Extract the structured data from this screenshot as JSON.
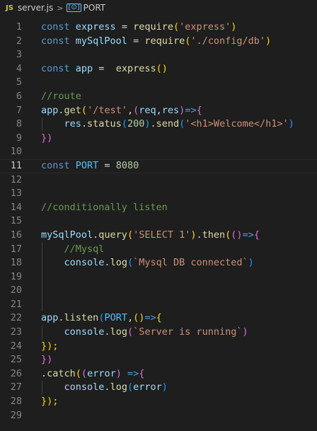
{
  "colors": {
    "background": "#1e1e1e",
    "keyword": "#569cd6",
    "function": "#dcdcaa",
    "variable": "#9cdcfe",
    "constant": "#4fc1ff",
    "string": "#ce9178",
    "number": "#b5cea8",
    "comment": "#6a9955",
    "plain": "#d4d4d4",
    "bracket1": "#ffd700",
    "bracket2": "#da70d6",
    "bracket3": "#179fff",
    "line_number": "#858585",
    "line_number_active": "#c6c6c6"
  },
  "breadcrumb": {
    "file_icon": "JS",
    "file_name": "server.js",
    "separator": ">",
    "symbol_icon": "symbol-constant-icon",
    "symbol_icon_glyph": "[⊙]",
    "symbol_name": "PORT"
  },
  "editor": {
    "active_line": 11,
    "lines": [
      {
        "n": "1",
        "tokens": [
          [
            "const",
            "keyword"
          ],
          [
            " ",
            "plain"
          ],
          [
            "express",
            "variable"
          ],
          [
            " = ",
            "plain"
          ],
          [
            "require",
            "function"
          ],
          [
            "(",
            "bracket1"
          ],
          [
            "'express'",
            "string"
          ],
          [
            ")",
            "bracket1"
          ]
        ]
      },
      {
        "n": "2",
        "tokens": [
          [
            "const",
            "keyword"
          ],
          [
            " ",
            "plain"
          ],
          [
            "mySqlPool",
            "variable"
          ],
          [
            " = ",
            "plain"
          ],
          [
            "require",
            "function"
          ],
          [
            "(",
            "bracket1"
          ],
          [
            "'./config/db'",
            "string"
          ],
          [
            ")",
            "bracket1"
          ]
        ]
      },
      {
        "n": "3",
        "tokens": []
      },
      {
        "n": "4",
        "tokens": [
          [
            "const",
            "keyword"
          ],
          [
            " ",
            "plain"
          ],
          [
            "app",
            "variable"
          ],
          [
            " =  ",
            "plain"
          ],
          [
            "express",
            "function"
          ],
          [
            "()",
            "bracket1"
          ]
        ]
      },
      {
        "n": "5",
        "tokens": []
      },
      {
        "n": "6",
        "tokens": [
          [
            "//route",
            "comment"
          ]
        ]
      },
      {
        "n": "7",
        "tokens": [
          [
            "app",
            "variable"
          ],
          [
            ".",
            "plain"
          ],
          [
            "get",
            "function"
          ],
          [
            "(",
            "bracket1"
          ],
          [
            "'/test'",
            "string"
          ],
          [
            ",",
            "plain"
          ],
          [
            "(",
            "bracket2"
          ],
          [
            "req",
            "variable"
          ],
          [
            ",",
            "plain"
          ],
          [
            "res",
            "variable"
          ],
          [
            ")",
            "bracket2"
          ],
          [
            "=>",
            "keyword"
          ],
          [
            "{",
            "bracket2"
          ]
        ]
      },
      {
        "n": "8",
        "tokens": [
          [
            "    ",
            "plain"
          ],
          [
            "res",
            "variable"
          ],
          [
            ".",
            "plain"
          ],
          [
            "status",
            "function"
          ],
          [
            "(",
            "bracket3"
          ],
          [
            "200",
            "number"
          ],
          [
            ")",
            "bracket3"
          ],
          [
            ".",
            "plain"
          ],
          [
            "send",
            "function"
          ],
          [
            "(",
            "bracket3"
          ],
          [
            "'<h1>Welcome</h1>'",
            "string"
          ],
          [
            ")",
            "bracket3"
          ]
        ]
      },
      {
        "n": "9",
        "tokens": [
          [
            "})",
            "bracket2"
          ]
        ]
      },
      {
        "n": "10",
        "tokens": []
      },
      {
        "n": "11",
        "tokens": [
          [
            "const",
            "keyword"
          ],
          [
            " ",
            "plain"
          ],
          [
            "PORT",
            "constant"
          ],
          [
            " = ",
            "plain"
          ],
          [
            "8080",
            "number"
          ]
        ]
      },
      {
        "n": "12",
        "tokens": []
      },
      {
        "n": "13",
        "tokens": []
      },
      {
        "n": "14",
        "tokens": [
          [
            "//conditionally listen",
            "comment"
          ]
        ]
      },
      {
        "n": "15",
        "tokens": []
      },
      {
        "n": "16",
        "tokens": [
          [
            "mySqlPool",
            "variable"
          ],
          [
            ".",
            "plain"
          ],
          [
            "query",
            "function"
          ],
          [
            "(",
            "bracket1"
          ],
          [
            "'SELECT 1'",
            "string"
          ],
          [
            ")",
            "bracket1"
          ],
          [
            ".",
            "plain"
          ],
          [
            "then",
            "function"
          ],
          [
            "(",
            "bracket1"
          ],
          [
            "()",
            "bracket2"
          ],
          [
            "=>",
            "keyword"
          ],
          [
            "{",
            "bracket2"
          ]
        ]
      },
      {
        "n": "17",
        "tokens": [
          [
            "    ",
            "plain"
          ],
          [
            "//Mysql",
            "comment"
          ]
        ]
      },
      {
        "n": "18",
        "tokens": [
          [
            "    ",
            "plain"
          ],
          [
            "console",
            "variable"
          ],
          [
            ".",
            "plain"
          ],
          [
            "log",
            "function"
          ],
          [
            "(",
            "bracket3"
          ],
          [
            "`Mysql DB connected`",
            "string"
          ],
          [
            ")",
            "bracket3"
          ]
        ]
      },
      {
        "n": "19",
        "tokens": []
      },
      {
        "n": "20",
        "tokens": []
      },
      {
        "n": "21",
        "tokens": []
      },
      {
        "n": "22",
        "tokens": [
          [
            "app",
            "variable"
          ],
          [
            ".",
            "plain"
          ],
          [
            "listen",
            "function"
          ],
          [
            "(",
            "bracket3"
          ],
          [
            "PORT",
            "constant"
          ],
          [
            ",",
            "plain"
          ],
          [
            "()",
            "bracket1"
          ],
          [
            "=>",
            "keyword"
          ],
          [
            "{",
            "bracket1"
          ]
        ]
      },
      {
        "n": "23",
        "tokens": [
          [
            "    ",
            "plain"
          ],
          [
            "console",
            "variable"
          ],
          [
            ".",
            "plain"
          ],
          [
            "log",
            "function"
          ],
          [
            "(",
            "bracket2"
          ],
          [
            "`Server is running`",
            "string"
          ],
          [
            ")",
            "bracket2"
          ]
        ]
      },
      {
        "n": "24",
        "tokens": [
          [
            "});",
            "bracket1"
          ]
        ]
      },
      {
        "n": "25",
        "tokens": [
          [
            "})",
            "bracket2"
          ]
        ]
      },
      {
        "n": "26",
        "tokens": [
          [
            ".",
            "plain"
          ],
          [
            "catch",
            "function"
          ],
          [
            "(",
            "bracket1"
          ],
          [
            "(",
            "bracket2"
          ],
          [
            "error",
            "variable"
          ],
          [
            ")",
            "bracket2"
          ],
          [
            " =>",
            "keyword"
          ],
          [
            "{",
            "bracket2"
          ]
        ]
      },
      {
        "n": "27",
        "tokens": [
          [
            "    ",
            "plain"
          ],
          [
            "console",
            "variable"
          ],
          [
            ".",
            "plain"
          ],
          [
            "log",
            "function"
          ],
          [
            "(",
            "bracket3"
          ],
          [
            "error",
            "variable"
          ],
          [
            ")",
            "bracket3"
          ]
        ]
      },
      {
        "n": "28",
        "tokens": [
          [
            "});",
            "bracket1"
          ]
        ]
      },
      {
        "n": "29",
        "tokens": []
      }
    ]
  }
}
